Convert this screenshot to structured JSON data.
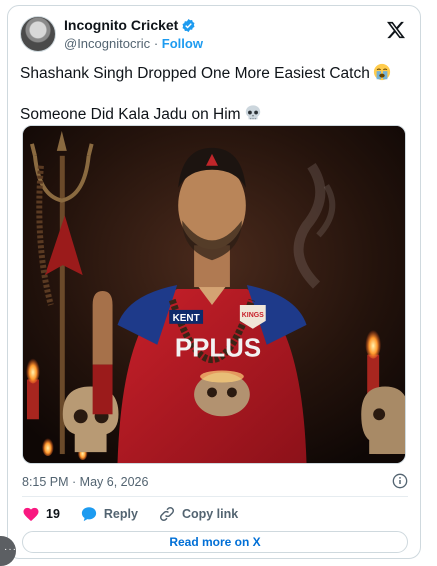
{
  "author": {
    "display_name": "Incognito Cricket",
    "handle": "@Incognitocric",
    "separator": "·",
    "follow_label": "Follow",
    "verified_color": "#1d9bf0"
  },
  "tweet": {
    "line1": "Shashank Singh Dropped One More Easiest Catch",
    "line1_emoji": "loudly-crying-face",
    "line2": "Someone Did Kala Jadu on Him",
    "line2_emoji": "skull",
    "media_text": {
      "sponsor_left": "KENT",
      "jersey_text": "PPLUS",
      "badge": "KINGS"
    }
  },
  "meta": {
    "timestamp": "8:15 PM · May 6, 2026"
  },
  "actions": {
    "likes_count": "19",
    "reply_label": "Reply",
    "copy_link_label": "Copy link",
    "like_color": "#f91880"
  },
  "footer": {
    "read_more_label": "Read more on X",
    "link_color": "#006fd6"
  },
  "colors": {
    "accent": "#1d9bf0",
    "muted_text": "#536471",
    "border": "#cfd9de"
  }
}
